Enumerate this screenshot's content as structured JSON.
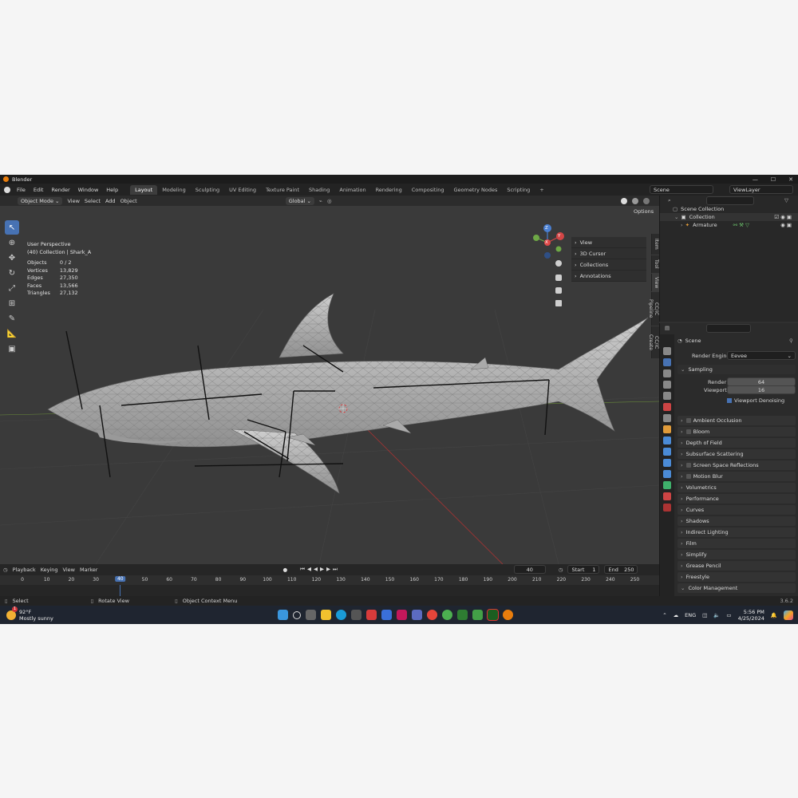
{
  "window": {
    "title": "Blender",
    "controls": [
      "—",
      "☐",
      "✕"
    ]
  },
  "menu": [
    "File",
    "Edit",
    "Render",
    "Window",
    "Help"
  ],
  "workspaces": [
    "Layout",
    "Modeling",
    "Sculpting",
    "UV Editing",
    "Texture Paint",
    "Shading",
    "Animation",
    "Rendering",
    "Compositing",
    "Geometry Nodes",
    "Scripting"
  ],
  "active_workspace": "Layout",
  "scene_field": "Scene",
  "viewlayer_field": "ViewLayer",
  "viewport": {
    "mode": "Object Mode",
    "menus": [
      "View",
      "Select",
      "Add",
      "Object"
    ],
    "orientation": "Global",
    "options_label": "Options",
    "overlay_title": "User Perspective",
    "overlay_sub": "(40) Collection | Shark_A",
    "stats": [
      {
        "label": "Objects",
        "value": "0 / 2"
      },
      {
        "label": "Vertices",
        "value": "13,829"
      },
      {
        "label": "Edges",
        "value": "27,350"
      },
      {
        "label": "Faces",
        "value": "13,566"
      },
      {
        "label": "Triangles",
        "value": "27,132"
      }
    ],
    "nav_items": [
      "View",
      "3D Cursor",
      "Collections",
      "Annotations"
    ],
    "side_tabs": [
      "Item",
      "Tool",
      "View",
      "CC/iC Pipeline",
      "CC/iC Create"
    ],
    "gizmo_labels": {
      "x": "X",
      "y": "Y",
      "z": "Z"
    }
  },
  "outliner": {
    "rows": [
      {
        "label": "Scene Collection"
      },
      {
        "label": "Collection"
      },
      {
        "label": "Armature"
      }
    ]
  },
  "properties": {
    "scene_label": "Scene",
    "render_engine_label": "Render Engine",
    "render_engine_value": "Eevee",
    "sampling_label": "Sampling",
    "render_label": "Render",
    "render_value": "64",
    "viewport_label": "Viewport",
    "viewport_value": "16",
    "denoise_label": "Viewport Denoising",
    "panels": [
      "Ambient Occlusion",
      "Bloom",
      "Depth of Field",
      "Subsurface Scattering",
      "Screen Space Reflections",
      "Motion Blur",
      "Volumetrics",
      "Performance",
      "Curves",
      "Shadows",
      "Indirect Lighting",
      "Film",
      "Simplify",
      "Grease Pencil",
      "Freestyle",
      "Color Management"
    ],
    "panels_with_checkbox": [
      "Ambient Occlusion",
      "Bloom",
      "Screen Space Reflections",
      "Motion Blur"
    ]
  },
  "timeline": {
    "menus": [
      "Playback",
      "Keying",
      "View",
      "Marker"
    ],
    "current_frame": "40",
    "start_label": "Start",
    "start_value": "1",
    "end_label": "End",
    "end_value": "250",
    "ticks": [
      "0",
      "10",
      "20",
      "30",
      "40",
      "50",
      "60",
      "70",
      "80",
      "90",
      "100",
      "110",
      "120",
      "130",
      "140",
      "150",
      "160",
      "170",
      "180",
      "190",
      "200",
      "210",
      "220",
      "230",
      "240",
      "250"
    ]
  },
  "statusbar": {
    "items": [
      "Select",
      "Rotate View",
      "Object Context Menu"
    ],
    "version": "3.6.2"
  },
  "taskbar": {
    "weather_temp": "92°F",
    "weather_desc": "Mostly sunny",
    "lang": "ENG",
    "time": "5:56 PM",
    "date": "4/25/2024",
    "weather_badge": "1"
  },
  "colors": {
    "accent": "#4772b3",
    "bg": "#303030",
    "mesh": "#b9b9b9"
  }
}
